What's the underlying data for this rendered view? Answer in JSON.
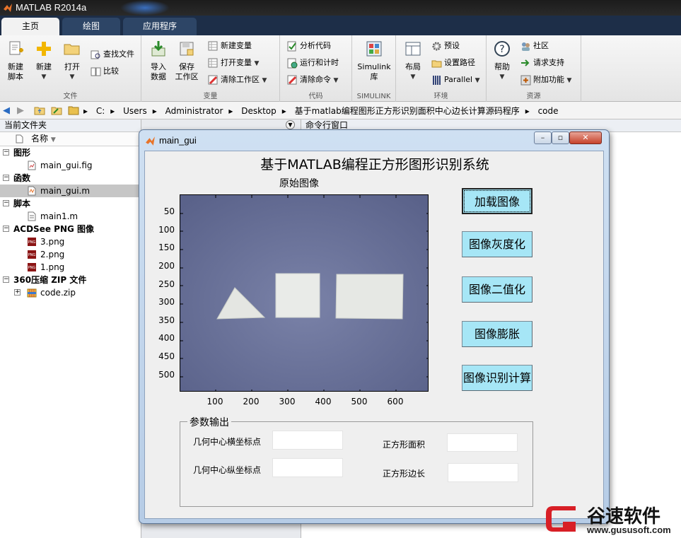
{
  "app": {
    "title": "MATLAB R2014a"
  },
  "tabs": [
    "主页",
    "绘图",
    "应用程序"
  ],
  "ribbon": {
    "file": {
      "caption": "文件",
      "new_script": "新建\n脚本",
      "new": "新建",
      "open": "打开",
      "find_files": "查找文件",
      "compare": "比较"
    },
    "variable": {
      "caption": "变量",
      "import": "导入\n数据",
      "save_ws": "保存\n工作区",
      "new_var": "新建变量",
      "open_var": "打开变量",
      "clear_ws": "清除工作区"
    },
    "code": {
      "caption": "代码",
      "analyze": "分析代码",
      "run_time": "运行和计时",
      "clear_cmd": "清除命令"
    },
    "simulink": {
      "caption": "SIMULINK",
      "simulink": "Simulink\n库"
    },
    "env": {
      "caption": "环境",
      "layout": "布局",
      "prefs": "预设",
      "set_path": "设置路径",
      "parallel": "Parallel"
    },
    "resources": {
      "caption": "资源",
      "help": "帮助",
      "community": "社区",
      "support": "请求支持",
      "addons": "附加功能"
    }
  },
  "address": {
    "crumbs": [
      "C:",
      "Users",
      "Administrator",
      "Desktop",
      "基于matlab编程图形正方形识别面积中心边长计算源码程序",
      "code"
    ]
  },
  "filepanel": {
    "title": "当前文件夹",
    "col_name": "名称",
    "groups": [
      {
        "label": "图形",
        "items": [
          {
            "name": "main_gui.fig",
            "icon": "fig-file-icon"
          }
        ]
      },
      {
        "label": "函数",
        "items": [
          {
            "name": "main_gui.m",
            "icon": "m-file-icon",
            "selected": true
          }
        ]
      },
      {
        "label": "脚本",
        "items": [
          {
            "name": "main1.m",
            "icon": "m-file-icon"
          }
        ]
      },
      {
        "label": "ACDSee PNG 图像",
        "items": [
          {
            "name": "3.png",
            "icon": "png-file-icon"
          },
          {
            "name": "2.png",
            "icon": "png-file-icon"
          },
          {
            "name": "1.png",
            "icon": "png-file-icon"
          }
        ]
      },
      {
        "label": "360压缩 ZIP 文件",
        "items": [
          {
            "name": "code.zip",
            "icon": "zip-file-icon"
          }
        ]
      }
    ]
  },
  "cmdpanel": {
    "title": "命令行窗口"
  },
  "figure": {
    "window_title": "main_gui",
    "gui_title": "基于MATLAB编程正方形图形识别系统",
    "axes_title": "原始图像",
    "yticks": [
      "50",
      "100",
      "150",
      "200",
      "250",
      "300",
      "350",
      "400",
      "450",
      "500"
    ],
    "xticks": [
      "100",
      "200",
      "300",
      "400",
      "500",
      "600"
    ],
    "buttons": [
      "加载图像",
      "图像灰度化",
      "图像二值化",
      "图像膨胀",
      "图像识别计算"
    ],
    "panel": {
      "title": "参数输出",
      "cx_label": "几何中心横坐标点",
      "cy_label": "几何中心纵坐标点",
      "area_label": "正方形面积",
      "side_label": "正方形边长"
    }
  },
  "watermark": {
    "name": "谷速软件",
    "url": "www.gususoft.com"
  }
}
